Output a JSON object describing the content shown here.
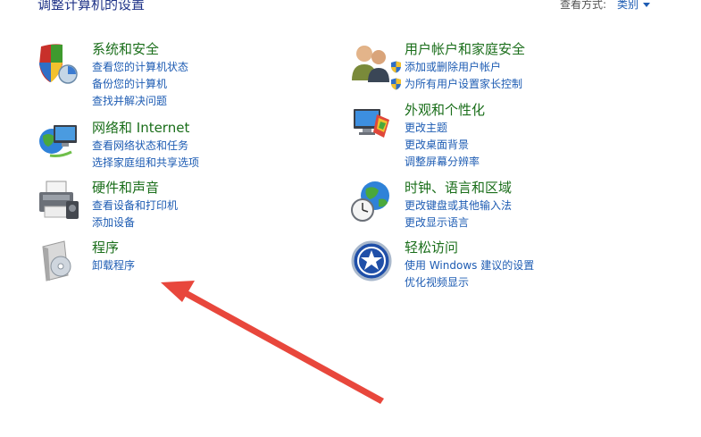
{
  "header": {
    "title": "调整计算机的设置"
  },
  "view_by": {
    "label": "查看方式:",
    "value": "类别"
  },
  "categories": [
    {
      "title": "系统和安全",
      "links": [
        "查看您的计算机状态",
        "备份您的计算机",
        "查找并解决问题"
      ]
    },
    {
      "title": "网络和 Internet",
      "links": [
        "查看网络状态和任务",
        "选择家庭组和共享选项"
      ]
    },
    {
      "title": "硬件和声音",
      "links": [
        "查看设备和打印机",
        "添加设备"
      ]
    },
    {
      "title": "程序",
      "links": [
        "卸载程序"
      ]
    },
    {
      "title": "用户帐户和家庭安全",
      "links": [
        "添加或删除用户帐户",
        "为所有用户设置家长控制"
      ]
    },
    {
      "title": "外观和个性化",
      "links": [
        "更改主题",
        "更改桌面背景",
        "调整屏幕分辨率"
      ]
    },
    {
      "title": "时钟、语言和区域",
      "links": [
        "更改键盘或其他输入法",
        "更改显示语言"
      ]
    },
    {
      "title": "轻松访问",
      "links": [
        "使用 Windows 建议的设置",
        "优化视频显示"
      ]
    }
  ],
  "colors": {
    "title_green": "#1a6e1a",
    "link_blue": "#1e5cb3",
    "annotation_red": "#e8473c"
  }
}
